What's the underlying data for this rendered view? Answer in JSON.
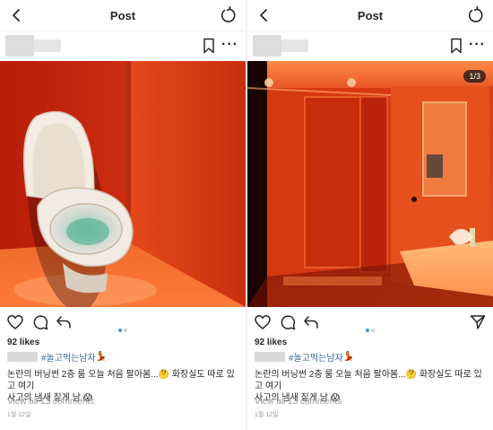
{
  "header": {
    "title": "Post"
  },
  "left_post": {
    "likes": "92 likes",
    "hashtag": "#놀고먹는남자",
    "hashtag_emoji": "💃",
    "caption_part1": "논란의 버닝썬 2층 룸 오늘 처음 팔아봄...",
    "caption_emoji1": "🤔",
    "caption_part2": "화장실도 따로 있고 여기",
    "caption_line2": "사고의 냄새 짙게 남",
    "caption_emoji2": "😱",
    "comments": "View all 13 comments",
    "date": "1월 12일"
  },
  "right_post": {
    "counter": "1/3",
    "likes": "92 likes",
    "hashtag": "#놀고먹는남자",
    "hashtag_emoji": "💃",
    "caption_part1": "논란의 버닝썬 2층 룸 오늘 처음 팔아봄...",
    "caption_emoji1": "🤔",
    "caption_part2": "화장실도 따로 있고 여기",
    "caption_line2": "사고의 냄새 짙게 남",
    "caption_emoji2": "😱",
    "comments": "View all 13 comments",
    "date": "1월 12일"
  },
  "icons": [
    "back-arrow-icon",
    "refresh-icon",
    "bookmark-icon",
    "more-icon",
    "heart-icon",
    "comment-icon",
    "share-icon",
    "send-icon"
  ],
  "colors": {
    "accent_blue": "#3897f0",
    "hashtag_blue": "#3864a6",
    "muted_gray": "#999999",
    "room_red": "#e23d17"
  }
}
